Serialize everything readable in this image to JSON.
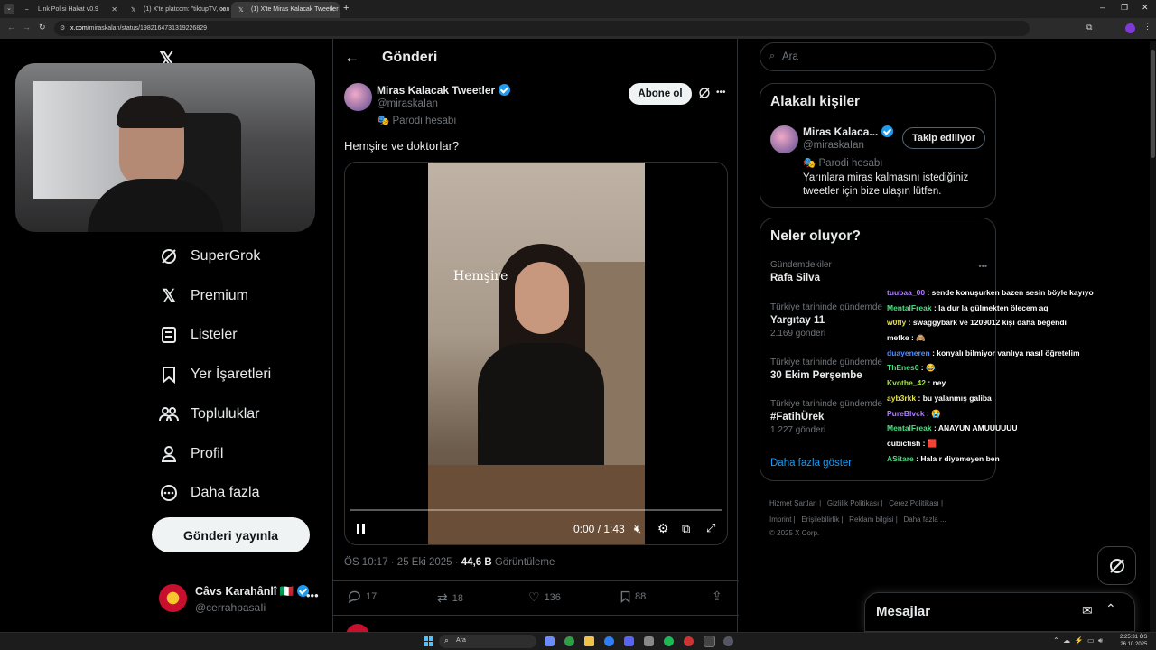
{
  "browser": {
    "tabs": [
      {
        "title": "Link Polisi Hakat v0.9",
        "active": false
      },
      {
        "title": "(1) X'te platcom: \"tiktupTV, can",
        "active": false
      },
      {
        "title": "(1) X'te Miras Kalacak Tweetler",
        "active": true
      }
    ],
    "url_domain": "x.com",
    "url_path": "/miraskalan/status/1982164731319226829"
  },
  "sidebar": {
    "items": [
      {
        "label": "SuperGrok",
        "icon": "grok-icon"
      },
      {
        "label": "Premium",
        "icon": "x-logo-icon"
      },
      {
        "label": "Listeler",
        "icon": "list-icon"
      },
      {
        "label": "Yer İşaretleri",
        "icon": "bookmark-icon"
      },
      {
        "label": "Topluluklar",
        "icon": "people-icon"
      },
      {
        "label": "Profil",
        "icon": "user-icon"
      },
      {
        "label": "Daha fazla",
        "icon": "more-circle-icon"
      }
    ],
    "post_button": "Gönderi yayınla",
    "account": {
      "name": "Câvs Karahânlî 🇮🇹",
      "handle": "@cerrahpasaIi"
    }
  },
  "post": {
    "header_title": "Gönderi",
    "author_name": "Miras Kalacak Tweetler",
    "author_handle": "@miraskaIan",
    "parody_label": "Parodi hesabı",
    "subscribe_label": "Abone ol",
    "text": "Hemşire ve doktorlar?",
    "video": {
      "overlay_text": "Hemşire",
      "time": "0:00 / 1:43",
      "progress": 0
    },
    "timestamp": "ÖS 10:17 · 25 Eki 2025 · ",
    "views": "44,6 B",
    "views_label": " Görüntüleme",
    "stats": {
      "replies": "17",
      "reposts": "18",
      "likes": "136",
      "bookmarks": "88"
    }
  },
  "right": {
    "search_placeholder": "Ara",
    "related": {
      "title": "Alakalı kişiler",
      "name": "Miras Kalaca...",
      "handle": "@miraskaIan",
      "parody_label": "Parodi hesabı",
      "follow_label": "Takip ediliyor",
      "bio": "Yarınlara miras kalmasını istediğiniz tweetler için bize ulaşın lütfen."
    },
    "trends": {
      "title": "Neler oluyor?",
      "items": [
        {
          "context": "Gündemdekiler",
          "name": "Rafa Silva",
          "count": ""
        },
        {
          "context": "Türkiye tarihinde gündemde",
          "name": "Yargıtay 11",
          "count": "2.169 gönderi"
        },
        {
          "context": "Türkiye tarihinde gündemde",
          "name": "30 Ekim Perşembe",
          "count": ""
        },
        {
          "context": "Türkiye tarihinde gündemde",
          "name": "#FatihÜrek",
          "count": "1.227 gönderi"
        }
      ],
      "show_more": "Daha fazla göster"
    },
    "footer": {
      "row1": [
        "Hizmet Şartları",
        "Gizlilik Politikası",
        "Çerez Politikası"
      ],
      "row2": [
        "Imprint",
        "Erişilebilirlik",
        "Reklam bilgisi",
        "Daha fazla ..."
      ],
      "copyright": "© 2025 X Corp."
    },
    "messages_label": "Mesajlar"
  },
  "chat": [
    {
      "user": "tuubaa_00",
      "msg": "sende konuşurken bazen sesin böyle kayıyo",
      "color": "#b07cff"
    },
    {
      "user": "MentalFreak",
      "msg": "la dur la gülmekten ölecem aq",
      "color": "#4ade80"
    },
    {
      "user": "w0fly",
      "msg": "swaggybark ve 1209012 kişi daha beğendi",
      "color": "#e5e056"
    },
    {
      "user": "mefke",
      "msg": "🙈",
      "color": "#ffffff"
    },
    {
      "user": "duayeneren",
      "msg": "konyalı bilmiyor vanlıya nasıl öğretelim",
      "color": "#4a8cff"
    },
    {
      "user": "ThEnes0",
      "msg": "😂",
      "color": "#4ade80"
    },
    {
      "user": "Kvothe_42",
      "msg": "ney",
      "color": "#a3e635"
    },
    {
      "user": "ayb3rkk",
      "msg": "bu yalanmış galiba",
      "color": "#e5e056"
    },
    {
      "user": "PureBlvck",
      "msg": "😭",
      "color": "#b07cff"
    },
    {
      "user": "MentalFreak",
      "msg": "ANAYUN AMUUUUUU",
      "color": "#4ade80"
    },
    {
      "user": "cubicfish",
      "msg": "🟥",
      "color": "#ffffff"
    },
    {
      "user": "ASitare",
      "msg": "Hala r diyemeyen ben",
      "color": "#4ade80"
    }
  ],
  "taskbar": {
    "search_placeholder": "Ara",
    "time": "2:25:31 ÖS",
    "date": "26.10.2025"
  }
}
